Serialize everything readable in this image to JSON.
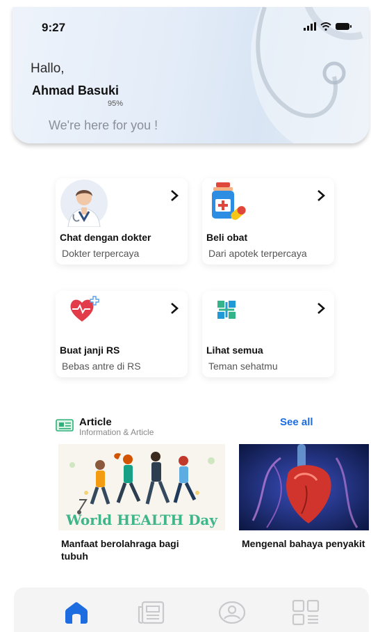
{
  "status_bar": {
    "time": "9:27"
  },
  "header": {
    "greeting": "Hallo,",
    "user_name": "Ahmad Basuki",
    "progress_text": "95%",
    "tagline": "We're here for you !"
  },
  "services": [
    {
      "title": "Chat dengan dokter",
      "subtitle": "Dokter terpercaya",
      "icon": "doctor-avatar-icon"
    },
    {
      "title": "Beli obat",
      "subtitle": "Dari apotek terpercaya",
      "icon": "medicine-bottle-icon"
    },
    {
      "title": "Buat janji RS",
      "subtitle": "Bebas antre di RS",
      "icon": "heart-cross-icon"
    },
    {
      "title": "Lihat semua",
      "subtitle": "Teman sehatmu",
      "icon": "grid-plus-icon"
    }
  ],
  "article_section": {
    "title": "Article",
    "subtitle": "Information & Article",
    "see_all": "See all",
    "items": [
      {
        "title": "Manfaat berolahraga bagi tubuh",
        "image_text": "World HEALTH Day"
      },
      {
        "title": "Mengenal bahaya penyakit"
      }
    ]
  },
  "bottom_nav": [
    {
      "name": "home",
      "active": true
    },
    {
      "name": "articles",
      "active": false
    },
    {
      "name": "profile",
      "active": false
    },
    {
      "name": "menu",
      "active": false
    }
  ],
  "colors": {
    "accent": "#1d6ce0",
    "inactive_icon": "#c9c9cc",
    "heart_red": "#e23b4a",
    "grid_green": "#34b38a"
  }
}
